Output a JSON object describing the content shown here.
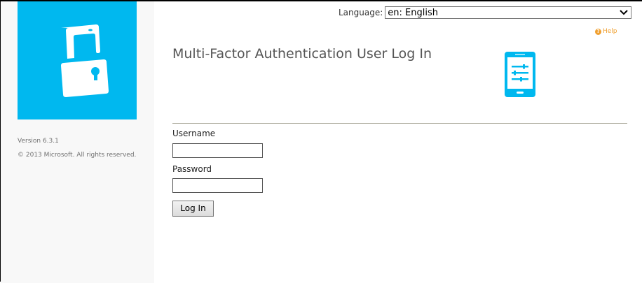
{
  "sidebar": {
    "version": "Version 6.3.1",
    "copyright": "© 2013 Microsoft. All rights reserved."
  },
  "header": {
    "language_label": "Language:",
    "language_value": "en: English",
    "help": "Help"
  },
  "main": {
    "title": "Multi-Factor Authentication User Log In",
    "username_label": "Username",
    "username_value": "",
    "password_label": "Password",
    "password_value": "",
    "login_button": "Log In"
  },
  "colors": {
    "brand": "#00b8ef",
    "help": "#f0a030"
  }
}
